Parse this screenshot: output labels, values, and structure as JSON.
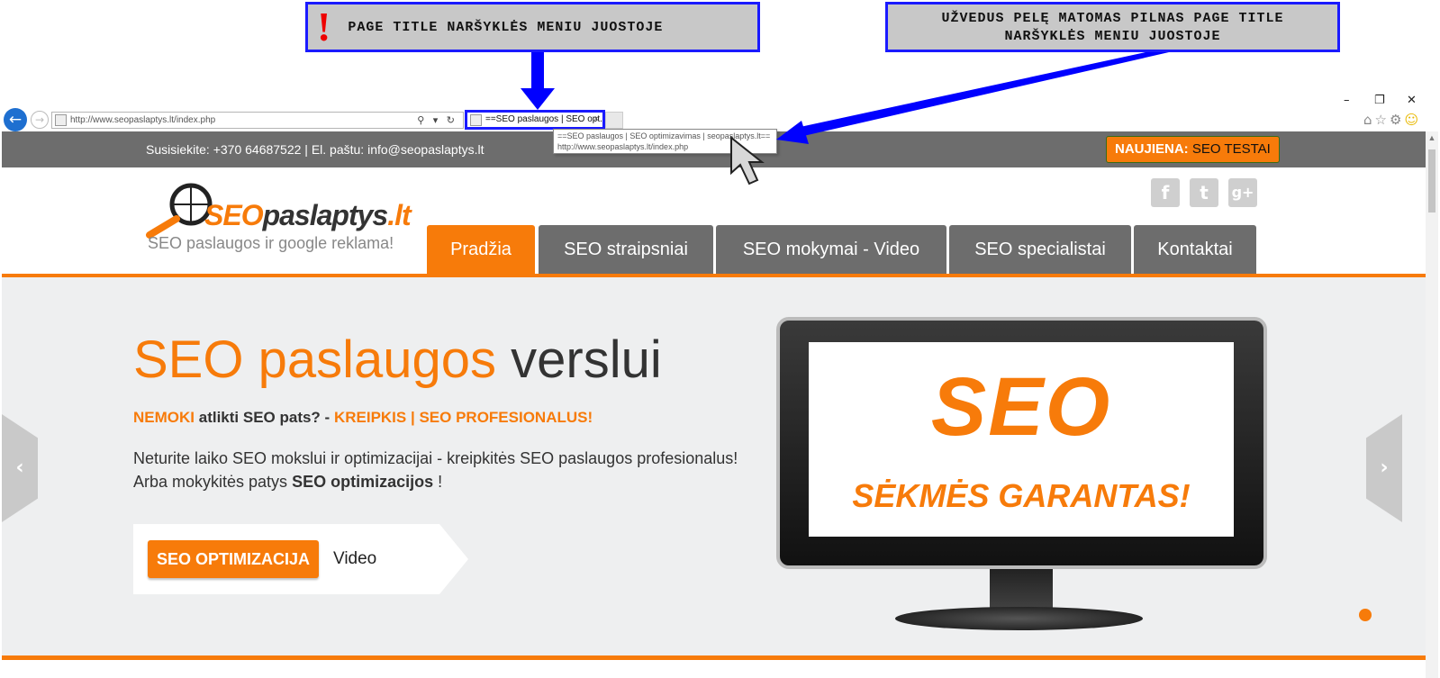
{
  "annotations": {
    "callout1": "PAGE TITLE NARŠYKLĖS MENIU JUOSTOJE",
    "callout1_mark": "!",
    "callout2_line1": "UŽVEDUS PELĘ MATOMAS PILNAS PAGE TITLE",
    "callout2_line2": "NARŠYKLĖS MENIU JUOSTOJE"
  },
  "browser": {
    "address": "http://www.seopaslaptys.lt/index.php",
    "tab_title": "==SEO paslaugos | SEO opt...",
    "tab_close": "×",
    "tooltip_title": "==SEO paslaugos | SEO optimizavimas | seopaslaptys.lt==",
    "tooltip_url": "http://www.seopaslaptys.lt/index.php",
    "back_icon": "←",
    "forward_icon": "→",
    "addr_tools": "⚲ ▾ ↻",
    "win_min": "–",
    "win_max": "❐",
    "win_close": "✕",
    "toolbar_icons": [
      "⌂",
      "☆",
      "⚙",
      "☺"
    ]
  },
  "site": {
    "contact": "Susisiekite: +370 64687522 | El. paštu: info@seopaslaptys.lt",
    "news_label": "NAUJIENA:",
    "news_text": "SEO TESTAI",
    "logo_seo": "SEO",
    "logo_rest": "paslaptys",
    "logo_tld": ".lt",
    "tagline": "SEO paslaugos ir google reklama!",
    "social": [
      "f",
      "t",
      "g+"
    ],
    "menu": [
      "Pradžia",
      "SEO straipsniai",
      "SEO mokymai - Video",
      "SEO specialistai",
      "Kontaktai"
    ],
    "hero": {
      "title_orange": "SEO paslaugos",
      "title_dark": "verslui",
      "sub_1": "NEMOKI",
      "sub_2": "atlikti SEO pats? -",
      "sub_3": "KREIPKIS | SEO PROFESIONALUS!",
      "p1": "Neturite laiko SEO mokslui ir optimizacijai - kreipkitės SEO paslaugos profesionalus!",
      "p2_a": "Arba mokykitės patys",
      "p2_b": "SEO optimizacijos",
      "p2_c": "!",
      "cta": "SEO OPTIMIZACIJA",
      "video": "Video",
      "screen_big": "SEO",
      "screen_small": "SĖKMĖS GARANTAS!",
      "prev": "‹",
      "next": "›"
    }
  },
  "colors": {
    "accent": "#f77b0a",
    "topbar": "#6d6d6d",
    "annotation": "#1a1aff"
  }
}
